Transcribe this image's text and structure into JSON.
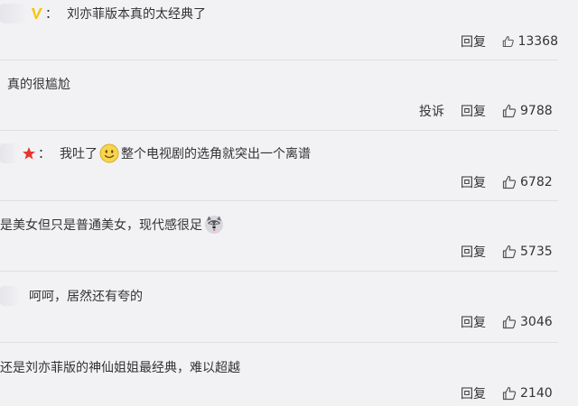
{
  "comments": [
    {
      "text": "刘亦菲版本真的太经典了",
      "report": "",
      "reply": "回复",
      "likes": "13368",
      "badge": "vip-v-icon"
    },
    {
      "text": "真的很尴尬",
      "report": "投诉",
      "reply": "回复",
      "likes": "9788"
    },
    {
      "text_before": "我吐了",
      "emoji": "smile-emoji-icon",
      "text_after": "整个电视剧的选角就突出一个离谱",
      "reply": "回复",
      "likes": "6782",
      "badge": "red-star-icon"
    },
    {
      "text": "是美女但只是普通美女，现代感很足",
      "emoji": "husky-emoji-icon",
      "reply": "回复",
      "likes": "5735"
    },
    {
      "text": "呵呵，居然还有夸的",
      "reply": "回复",
      "likes": "3046"
    },
    {
      "text": "还是刘亦菲版的神仙姐姐最经典，难以超越",
      "reply": "回复",
      "likes": "2140"
    }
  ],
  "colon": "："
}
